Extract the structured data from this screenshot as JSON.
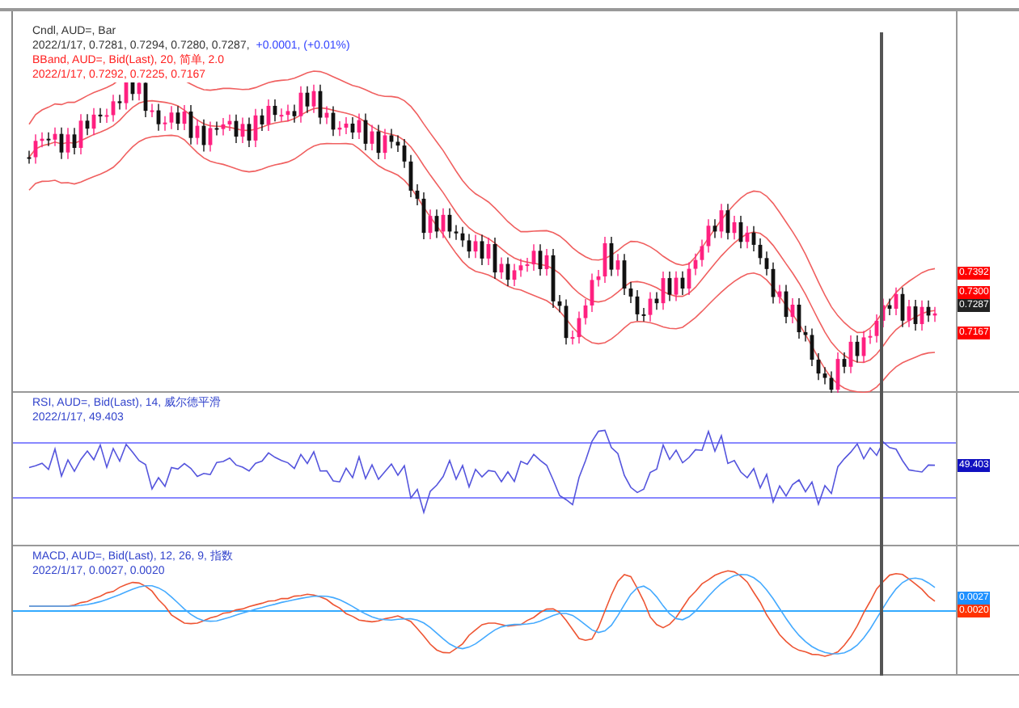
{
  "price_pane": {
    "legend": [
      {
        "text": "Cndl, AUD=, Bar",
        "color": "#333333"
      },
      {
        "text": "2022/1/17, 0.7281, 0.7294, 0.7280, 0.7287,",
        "color": "#333333",
        "change": "+0.0001, (+0.01%)"
      },
      {
        "text": "BBand, AUD=, Bid(Last), 20, 简单, 2.0",
        "color": "#ff2020"
      },
      {
        "text": "2022/1/17, 0.7292, 0.7225, 0.7167",
        "color": "#ff2020"
      }
    ],
    "tags": [
      {
        "text": "0.7392",
        "color": "#ff0000"
      },
      {
        "text": "0.7300",
        "color": "#ff0000"
      },
      {
        "text": "0.7287",
        "color": "#222222"
      },
      {
        "text": "0.7167",
        "color": "#ff0000"
      }
    ]
  },
  "rsi_pane": {
    "legend": [
      {
        "text": "RSI, AUD=, Bid(Last), 14, 威尔德平滑",
        "color": "#3344cc"
      },
      {
        "text": "2022/1/17, 49.403",
        "color": "#3344cc"
      }
    ],
    "tags": [
      {
        "text": "49.403",
        "color": "#1010c0"
      }
    ]
  },
  "macd_pane": {
    "legend": [
      {
        "text": "MACD, AUD=, Bid(Last), 12, 26, 9, 指数",
        "color": "#3344cc"
      },
      {
        "text": "2022/1/17, 0.0027, 0.0020",
        "color": "#3344cc"
      }
    ],
    "tags": [
      {
        "text": "0.0027",
        "color": "#1e90ff"
      },
      {
        "text": "0.0020",
        "color": "#ff3300"
      }
    ]
  }
}
